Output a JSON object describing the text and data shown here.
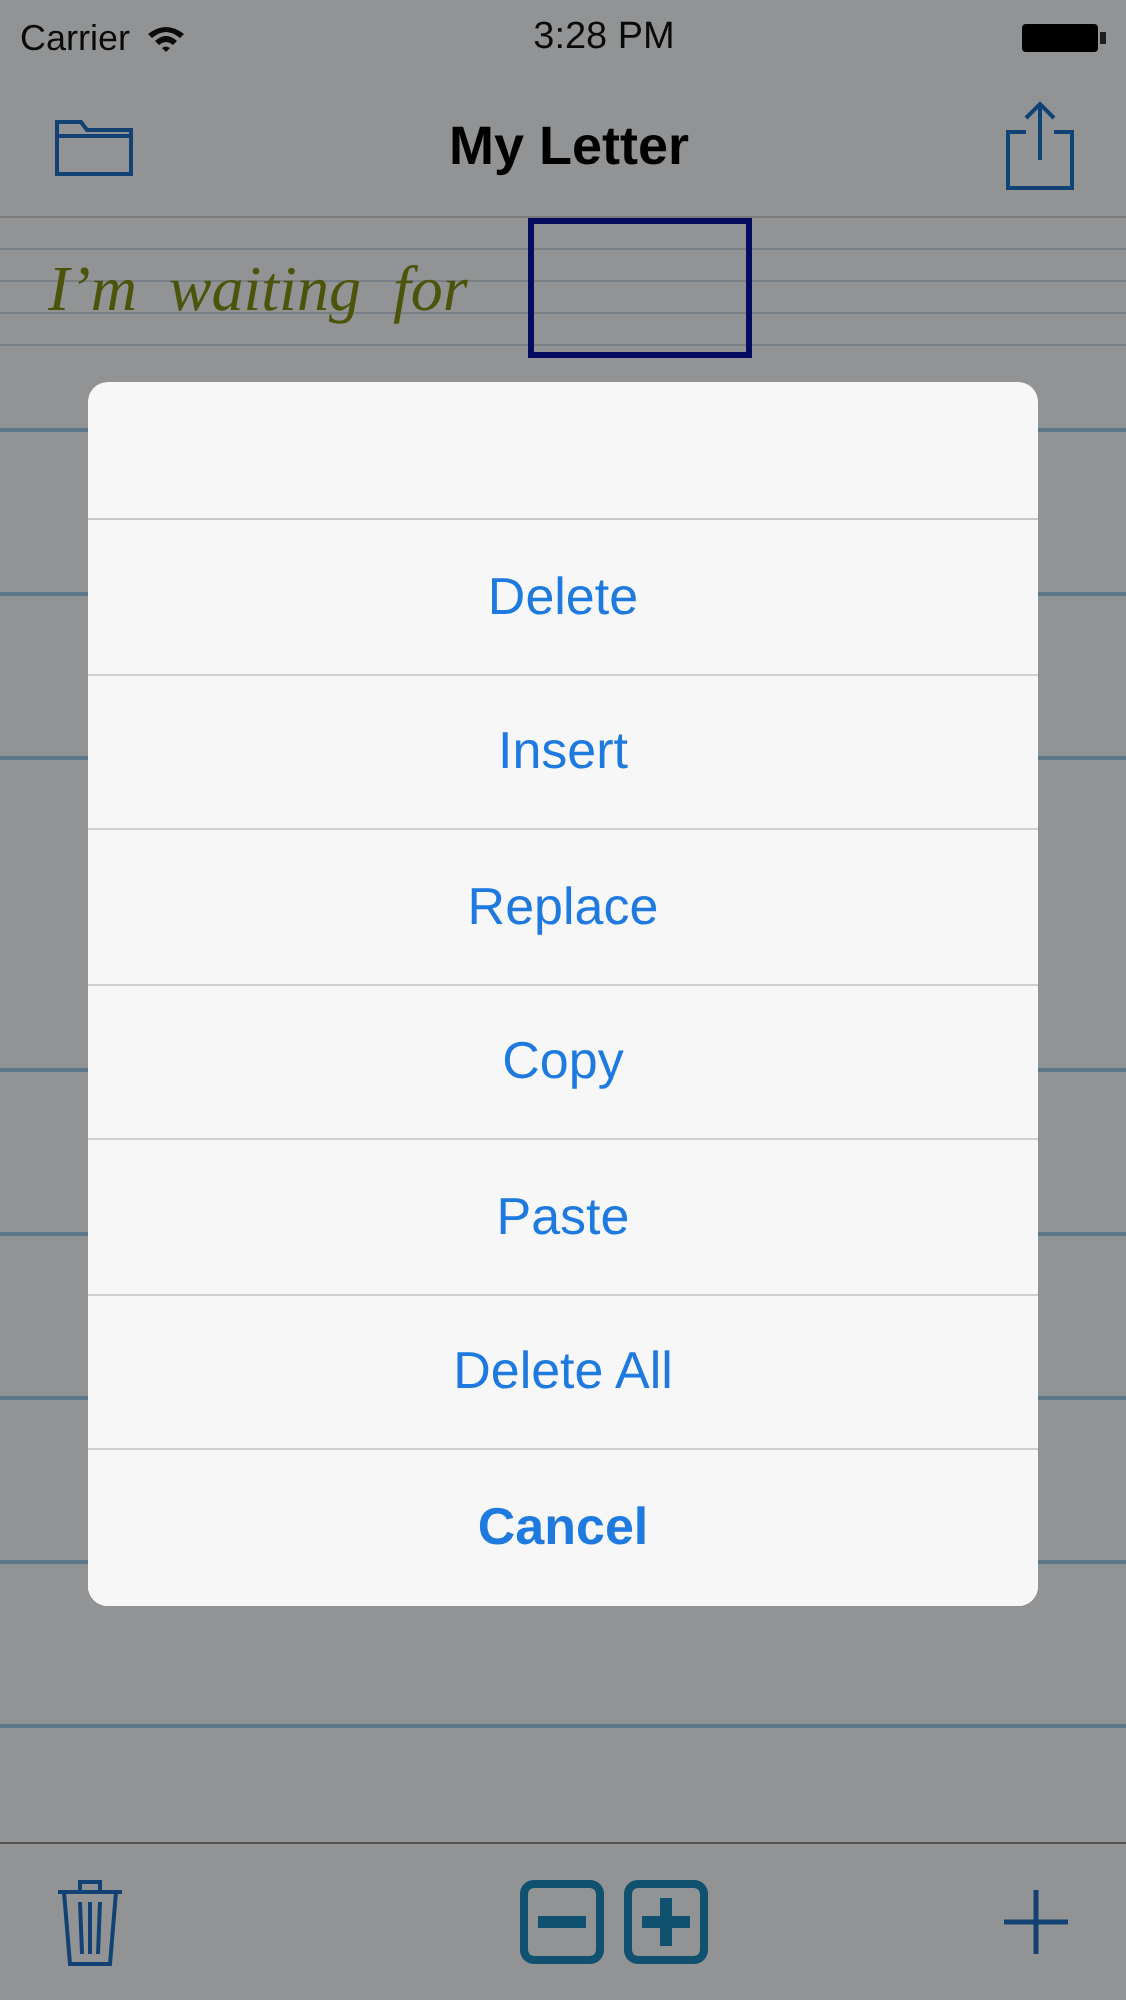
{
  "status_bar": {
    "carrier": "Carrier",
    "time": "3:28 PM"
  },
  "nav_bar": {
    "title": "My Letter"
  },
  "document": {
    "handwriting": "I’m  waiting  for"
  },
  "action_sheet": {
    "items": [
      {
        "label": "Delete",
        "kind": "action"
      },
      {
        "label": "Insert",
        "kind": "action"
      },
      {
        "label": "Replace",
        "kind": "action"
      },
      {
        "label": "Copy",
        "kind": "action"
      },
      {
        "label": "Paste",
        "kind": "action"
      },
      {
        "label": "Delete All",
        "kind": "action"
      },
      {
        "label": "Cancel",
        "kind": "cancel"
      }
    ]
  }
}
